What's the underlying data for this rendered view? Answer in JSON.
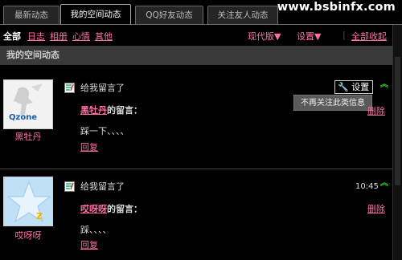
{
  "watermark": "www.bsbinfx.com",
  "tabs": [
    {
      "label": "最新动态"
    },
    {
      "label": "我的空间动态"
    },
    {
      "label": "QQ好友动态"
    },
    {
      "label": "关注友人动态"
    }
  ],
  "filter": {
    "all": "全部",
    "links": [
      "日志",
      "相册",
      "心情",
      "其他"
    ],
    "view_mode": "现代版▼",
    "settings": "设置▼",
    "sep": "|",
    "collapse_all": "全部收起"
  },
  "section_title": "我的空间动态",
  "feed": [
    {
      "nickname": "黑牡丹",
      "avatar_badge": "Qzone",
      "action": "给我留言了",
      "author": "黑牡丹",
      "msg_suffix": "的留言：",
      "content": "踩一下、、、、",
      "reply": "回复",
      "delete": "删除",
      "settings": "设置",
      "tooltip": "不再关注此类信息"
    },
    {
      "nickname": "哎呀呀",
      "action": "给我留言了",
      "author": "哎呀呀",
      "msg_suffix": "的留言：",
      "content": "踩、、、、",
      "reply": "回复",
      "delete": "删除",
      "time": "10:45"
    }
  ],
  "colors": {
    "link": "#ff6fa8",
    "arrow": "#33cc33",
    "background": "#000000"
  }
}
